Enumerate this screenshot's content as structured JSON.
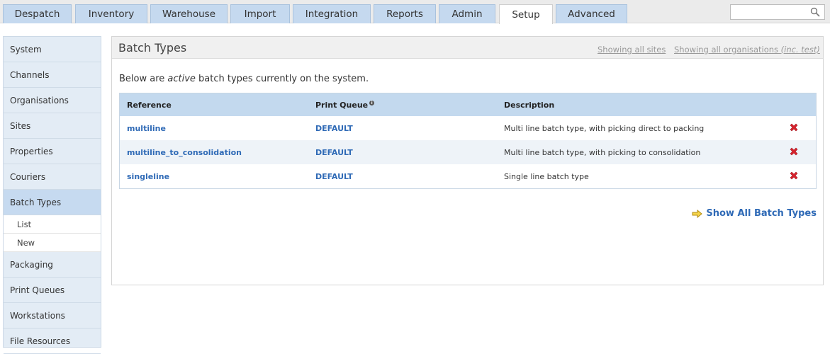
{
  "tabs": [
    {
      "label": "Despatch"
    },
    {
      "label": "Inventory"
    },
    {
      "label": "Warehouse"
    },
    {
      "label": "Import"
    },
    {
      "label": "Integration"
    },
    {
      "label": "Reports"
    },
    {
      "label": "Admin"
    },
    {
      "label": "Setup"
    },
    {
      "label": "Advanced"
    }
  ],
  "active_tab": "Setup",
  "search": {
    "placeholder": "",
    "icon": "search-icon"
  },
  "sidebar": {
    "items": [
      {
        "label": "System"
      },
      {
        "label": "Channels"
      },
      {
        "label": "Organisations"
      },
      {
        "label": "Sites"
      },
      {
        "label": "Properties"
      },
      {
        "label": "Couriers"
      },
      {
        "label": "Batch Types"
      },
      {
        "label": "Packaging"
      },
      {
        "label": "Print Queues"
      },
      {
        "label": "Workstations"
      },
      {
        "label": "File Resources"
      }
    ],
    "sub_items": [
      {
        "label": "List"
      },
      {
        "label": "New"
      }
    ]
  },
  "main": {
    "title": "Batch Types",
    "sites_link": "Showing all sites",
    "orgs_link_prefix": "Showing all organisations",
    "orgs_link_suffix": "(inc. test)",
    "intro_before": "Below are ",
    "intro_em": "active",
    "intro_after": " batch types currently on the system.",
    "table": {
      "headers": {
        "reference": "Reference",
        "print_queue": "Print Queue",
        "description": "Description"
      },
      "rows": [
        {
          "reference": "multiline",
          "print_queue": "DEFAULT",
          "description": "Multi line batch type, with picking direct to packing"
        },
        {
          "reference": "multiline_to_consolidation",
          "print_queue": "DEFAULT",
          "description": "Multi line batch type, with picking to consolidation"
        },
        {
          "reference": "singleline",
          "print_queue": "DEFAULT",
          "description": "Single line batch type"
        }
      ]
    },
    "show_all": "Show All Batch Types"
  },
  "colors": {
    "accent": "#2f6ab6",
    "tab": "#c5d9ef",
    "delete": "#d9232d"
  }
}
